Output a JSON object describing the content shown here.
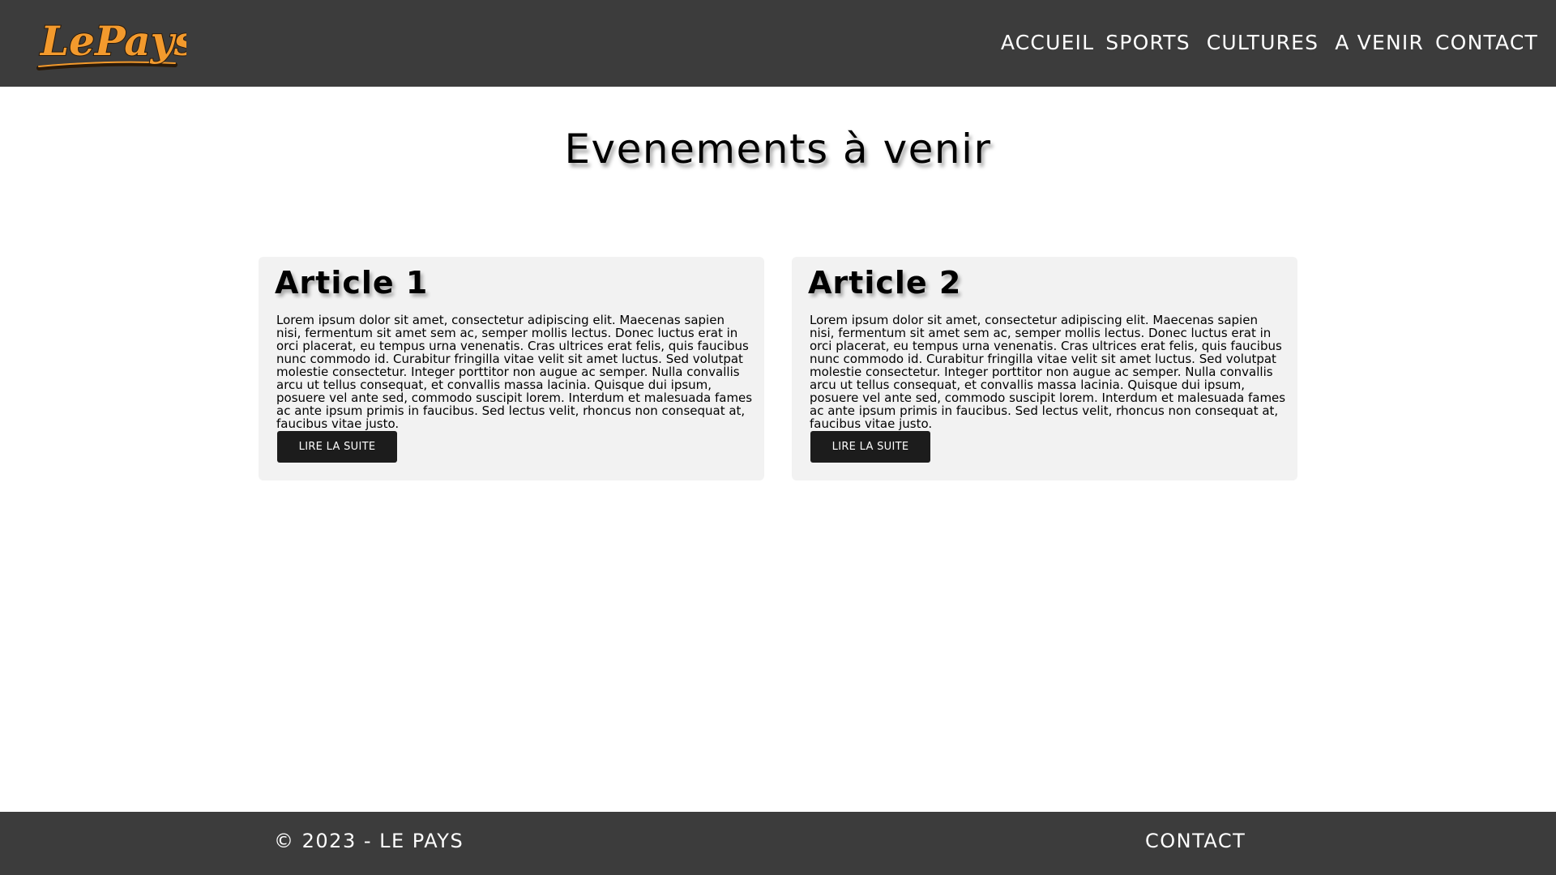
{
  "header": {
    "logo_text": "LePays",
    "nav": [
      {
        "label": "ACCUEIL"
      },
      {
        "label": "SPORTS"
      },
      {
        "label": "CULTURES"
      },
      {
        "label": "A VENIR"
      },
      {
        "label": "CONTACT"
      }
    ]
  },
  "main": {
    "title": "Evenements à venir",
    "articles": [
      {
        "title": "Article 1",
        "body": "Lorem ipsum dolor sit amet, consectetur adipiscing elit. Maecenas sapien nisi, fermentum sit amet sem ac, semper mollis lectus. Donec luctus erat in orci placerat, eu tempus urna venenatis. Cras ultrices erat felis, quis faucibus nunc commodo id. Curabitur fringilla vitae velit sit amet luctus. Sed volutpat molestie consectetur. Integer porttitor non augue ac semper. Nulla convallis arcu ut tellus consequat, et convallis massa lacinia. Quisque dui ipsum, posuere vel ante sed, commodo suscipit lorem. Interdum et malesuada fames ac ante ipsum primis in faucibus. Sed lectus velit, rhoncus non consequat at, faucibus vitae justo.",
        "button_label": "LIRE LA SUITE"
      },
      {
        "title": "Article 2",
        "body": "Lorem ipsum dolor sit amet, consectetur adipiscing elit. Maecenas sapien nisi, fermentum sit amet sem ac, semper mollis lectus. Donec luctus erat in orci placerat, eu tempus urna venenatis. Cras ultrices erat felis, quis faucibus nunc commodo id. Curabitur fringilla vitae velit sit amet luctus. Sed volutpat molestie consectetur. Integer porttitor non augue ac semper. Nulla convallis arcu ut tellus consequat, et convallis massa lacinia. Quisque dui ipsum, posuere vel ante sed, commodo suscipit lorem. Interdum et malesuada fames ac ante ipsum primis in faucibus. Sed lectus velit, rhoncus non consequat at, faucibus vitae justo.",
        "button_label": "LIRE LA SUITE"
      }
    ]
  },
  "footer": {
    "copyright": "© 2023 - LE PAYS",
    "contact_label": "CONTACT"
  },
  "colors": {
    "header_bg": "#3c3c3c",
    "footer_bg": "#3c3c3c",
    "card_bg": "#f2f2f2",
    "button_bg": "#1c1c1c",
    "logo_accent": "#f39a2d"
  }
}
